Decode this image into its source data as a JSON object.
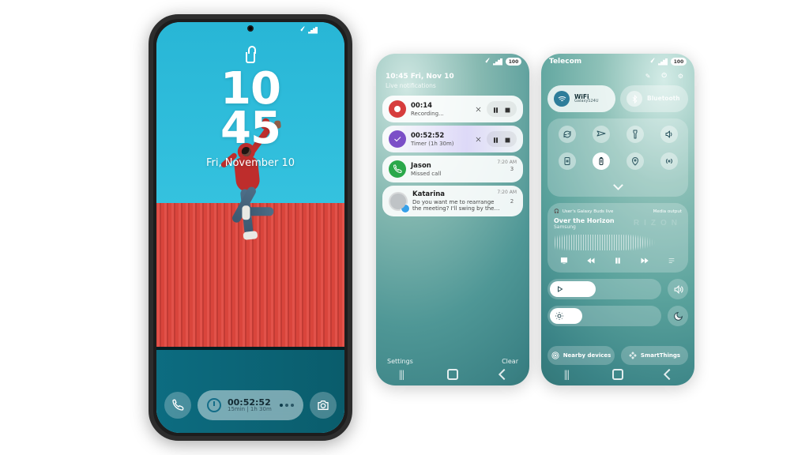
{
  "status_bar": {
    "battery_text": "100"
  },
  "phone1": {
    "time_top": "10",
    "time_bottom": "45",
    "date": "Fri, November 10",
    "timer_pill": {
      "elapsed": "00:52:52",
      "subtitle": "15min | 1h 30m"
    }
  },
  "panel2": {
    "time_date": "10:45 Fri, Nov 10",
    "header": "Live notifications",
    "recorder": {
      "elapsed": "00:14",
      "label": "Recording..."
    },
    "timer": {
      "elapsed": "00:52:52",
      "label": "Timer (1h 30m)"
    },
    "call": {
      "name": "Jason",
      "time": "7:20 AM",
      "label": "Missed call",
      "count": "3"
    },
    "message": {
      "name": "Katarina",
      "time": "7:20 AM",
      "body": "Do you want me to rearrange the meeting? I'll swing by the offic…",
      "count": "2"
    },
    "settings": "Settings",
    "clear": "Clear"
  },
  "panel3": {
    "carrier": "Telecom",
    "wifi": {
      "label": "WiFi",
      "ssid": "GalaxyS24U"
    },
    "bluetooth": {
      "label": "Bluetooth"
    },
    "media": {
      "device_label": "User's Galaxy Buds live",
      "output_label": "Media output",
      "title": "Over the Horizon",
      "artist": "Samsung",
      "brand": "RIZON"
    },
    "nearby": "Nearby devices",
    "smartthings": "SmartThings"
  }
}
